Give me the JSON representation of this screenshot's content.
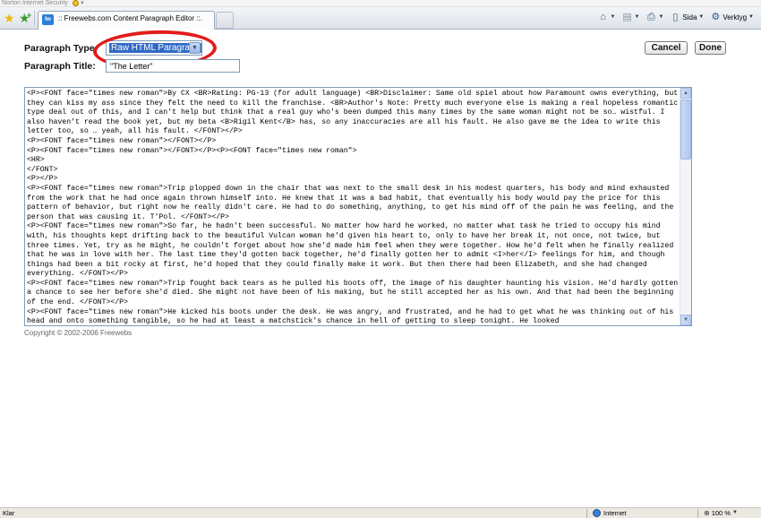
{
  "browser": {
    "norton_label": "Norton Internet Security",
    "tab_title": ":: Freewebs.com Content Paragraph Editor ::.",
    "toolbar": {
      "home_icon": "home-icon",
      "feeds_icon": "feeds-icon",
      "print_icon": "print-icon",
      "page_label": "Sida",
      "tools_label": "Verktyg"
    }
  },
  "form": {
    "paragraph_type_label": "Paragraph Type:",
    "paragraph_type_value": "Raw HTML Paragraph",
    "paragraph_title_label": "Paragraph Title:",
    "paragraph_title_value": "\"The Letter\"",
    "cancel_label": "Cancel",
    "done_label": "Done"
  },
  "editor": {
    "content": "<P><FONT face=\"times new roman\">By CX <BR>Rating: PG-13 (for adult language) <BR>Disclaimer: Same old spiel about how Paramount owns everything, but they can kiss my ass since they felt the need to kill the franchise. <BR>Author's Note: Pretty much everyone else is making a real hopeless romantic type deal out of this, and I can't help but think that a real guy who's been dumped this many times by the same woman might not be so… wistful. I also haven't read the book yet, but my beta <B>Rigil Kent</B> has, so any inaccuracies are all his fault. He also gave me the idea to write this letter too, so … yeah, all his fault. </FONT></P>\n<P><FONT face=\"times new roman\"></FONT></P>\n<P><FONT face=\"times new roman\"></FONT></P><P><FONT face=\"times new roman\">\n<HR>\n</FONT>\n<P></P>\n<P><FONT face=\"times new roman\">Trip plopped down in the chair that was next to the small desk in his modest quarters, his body and mind exhausted from the work that he had once again thrown himself into. He knew that it was a bad habit, that eventually his body would pay the price for this pattern of behavior, but right now he really didn't care. He had to do something, anything, to get his mind off of the pain he was feeling, and the person that was causing it. T'Pol. </FONT></P>\n<P><FONT face=\"times new roman\">So far, he hadn't been successful. No matter how hard he worked, no matter what task he tried to occupy his mind with, his thoughts kept drifting back to the beautiful Vulcan woman he'd given his heart to, only to have her break it, not once, not twice, but three times. Yet, try as he might, he couldn't forget about how she'd made him feel when they were together. How he'd felt when he finally realized that he was in love with her. The last time they'd gotten back together, he'd finally gotten her to admit <I>her</I> feelings for him, and though things had been a bit rocky at first, he'd hoped that they could finally make it work. But then there had been Elizabeth, and she had changed everything. </FONT></P>\n<P><FONT face=\"times new roman\">Trip fought back tears as he pulled his boots off, the image of his daughter haunting his vision. He'd hardly gotten a chance to see her before she'd died. She might not have been of his making, but he still accepted her as his own. And that had been the beginning of the end. </FONT></P>\n<P><FONT face=\"times new roman\">He kicked his boots under the desk. He was angry, and frustrated, and he had to get what he was thinking out of his head and onto something tangible, so he had at least a matchstick's chance in hell of getting to sleep tonight. He looked"
  },
  "footer": {
    "copyright": "Copyright © 2002-2006 Freewebs"
  },
  "status_bar": {
    "status_text": "Klar",
    "zone_label": "Internet",
    "zoom_label": "100 %"
  },
  "colors": {
    "annotation_circle": "#e21c1c",
    "selection_highlight": "#316ac5"
  }
}
